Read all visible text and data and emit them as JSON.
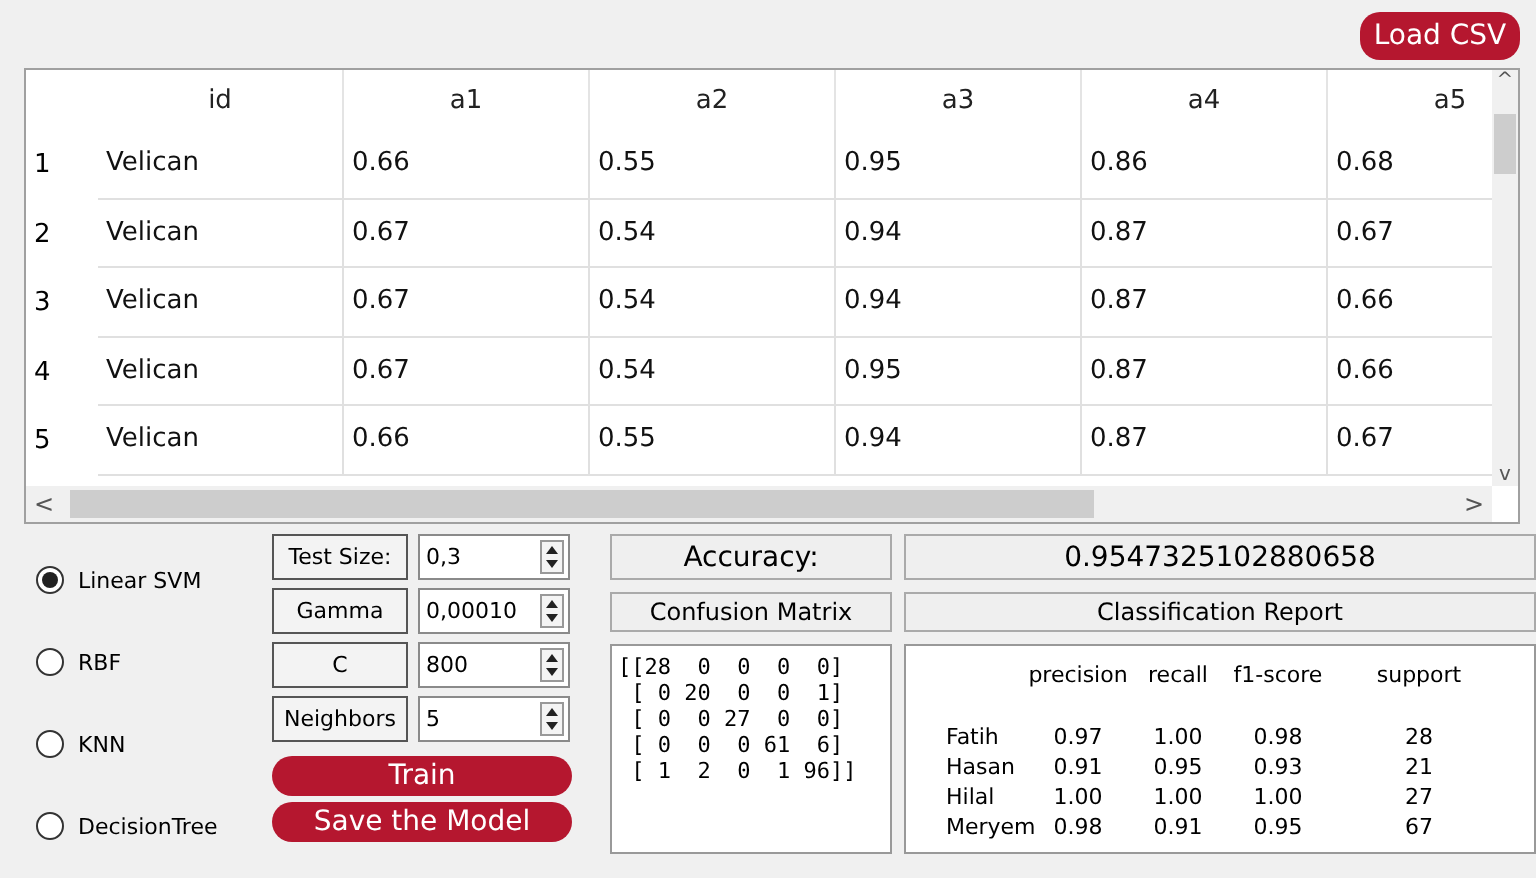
{
  "load_button": "Load CSV",
  "table": {
    "columns": [
      "id",
      "a1",
      "a2",
      "a3",
      "a4",
      "a5"
    ],
    "rows": [
      {
        "index": "1",
        "cells": [
          "Velican",
          "0.66",
          "0.55",
          "0.95",
          "0.86",
          "0.68"
        ]
      },
      {
        "index": "2",
        "cells": [
          "Velican",
          "0.67",
          "0.54",
          "0.94",
          "0.87",
          "0.67"
        ]
      },
      {
        "index": "3",
        "cells": [
          "Velican",
          "0.67",
          "0.54",
          "0.94",
          "0.87",
          "0.66"
        ]
      },
      {
        "index": "4",
        "cells": [
          "Velican",
          "0.67",
          "0.54",
          "0.95",
          "0.87",
          "0.66"
        ]
      },
      {
        "index": "5",
        "cells": [
          "Velican",
          "0.66",
          "0.55",
          "0.94",
          "0.87",
          "0.67"
        ]
      }
    ],
    "scroll_left": "<",
    "scroll_right": ">",
    "scroll_up": "^",
    "scroll_down": "v"
  },
  "models": [
    {
      "label": "Linear SVM",
      "selected": true
    },
    {
      "label": "RBF",
      "selected": false
    },
    {
      "label": "KNN",
      "selected": false
    },
    {
      "label": "DecisionTree",
      "selected": false
    }
  ],
  "params": [
    {
      "label": "Test Size:",
      "value": "0,3"
    },
    {
      "label": "Gamma",
      "value": "0,00010"
    },
    {
      "label": "C",
      "value": "800"
    },
    {
      "label": "Neighbors",
      "value": "5"
    }
  ],
  "train_button": "Train",
  "save_button": "Save the Model",
  "accuracy_label": "Accuracy:",
  "accuracy_value": "0.9547325102880658",
  "confusion_title": "Confusion Matrix",
  "confusion_lines": [
    "[[28  0  0  0  0]",
    " [ 0 20  0  0  1]",
    " [ 0  0 27  0  0]",
    " [ 0  0  0 61  6]",
    " [ 1  2  0  1 96]]"
  ],
  "report_title": "Classification Report",
  "report_header": [
    "precision",
    "recall",
    "f1-score",
    "support"
  ],
  "report_rows": [
    {
      "label": "Fatih",
      "cells": [
        "0.97",
        "1.00",
        "0.98",
        "28"
      ]
    },
    {
      "label": "Hasan",
      "cells": [
        "0.91",
        "0.95",
        "0.93",
        "21"
      ]
    },
    {
      "label": "Hilal",
      "cells": [
        "1.00",
        "1.00",
        "1.00",
        "27"
      ]
    },
    {
      "label": "Meryem",
      "cells": [
        "0.98",
        "0.91",
        "0.95",
        "67"
      ]
    }
  ]
}
